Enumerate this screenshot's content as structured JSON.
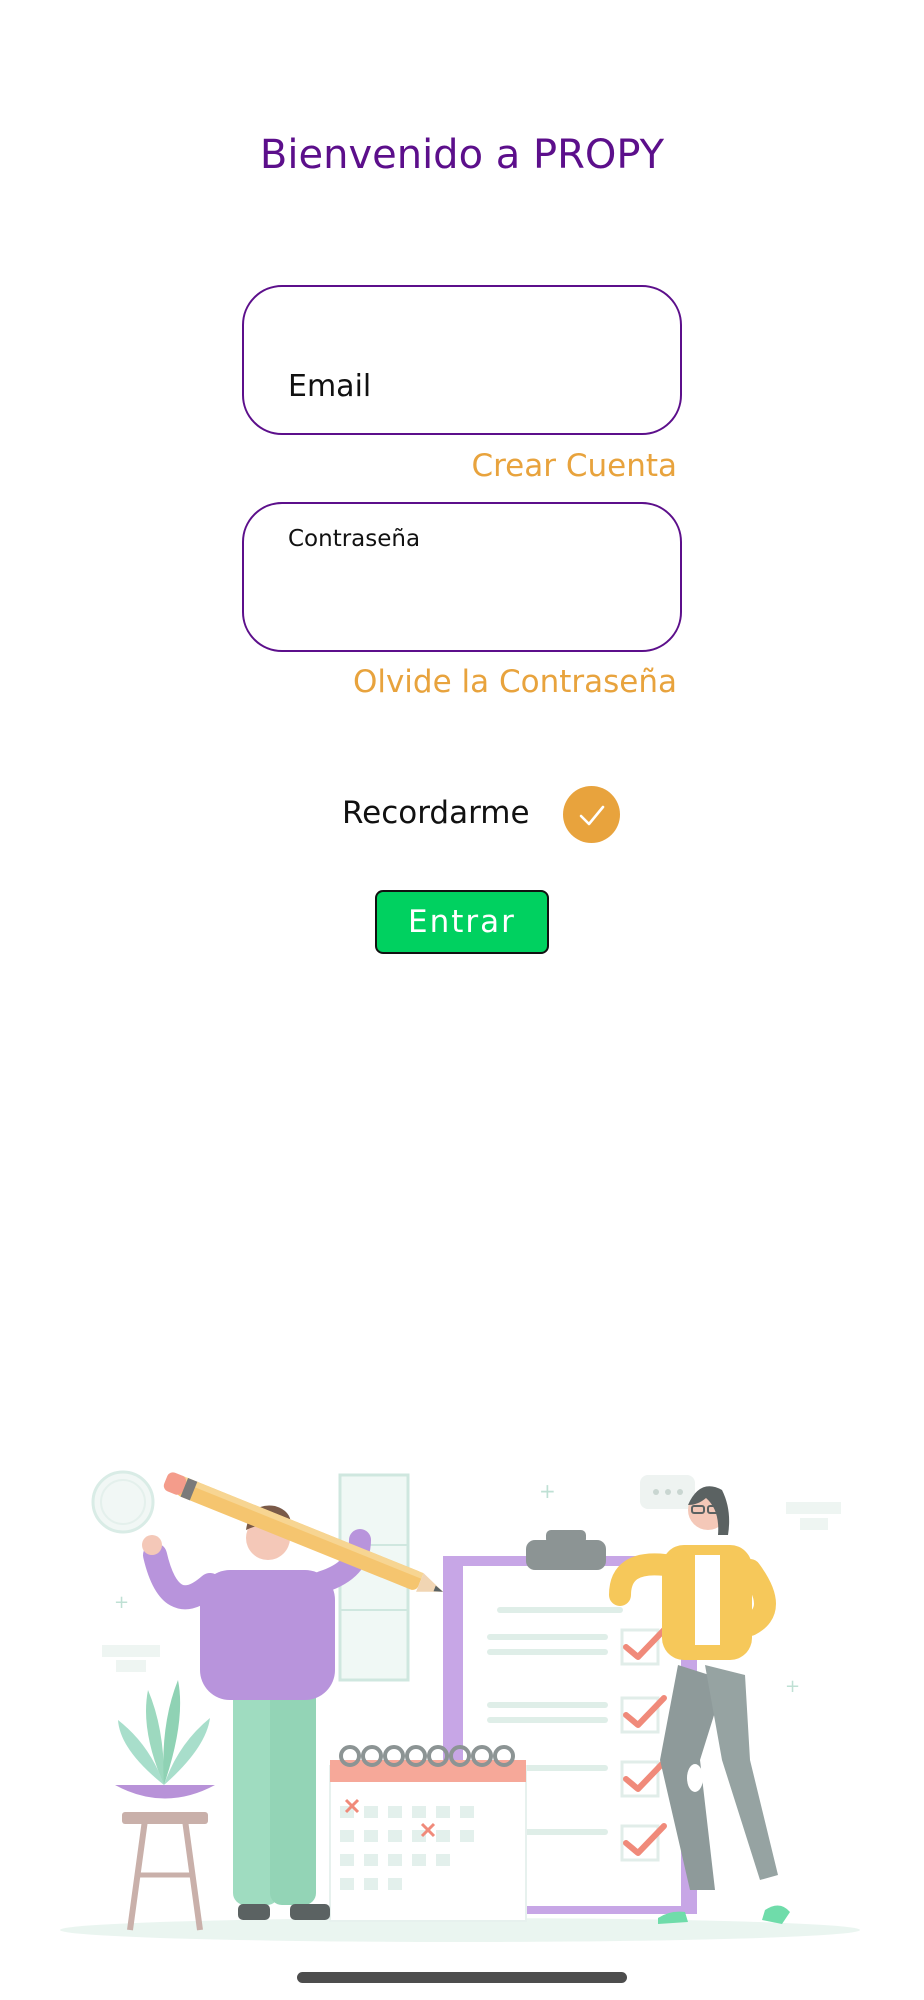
{
  "header": {
    "title": "Bienvenido a PROPY"
  },
  "form": {
    "email_label": "Email",
    "create_account_link": "Crear Cuenta",
    "password_label": "Contraseña",
    "forgot_password_link": "Olvide la Contraseña",
    "remember_label": "Recordarme",
    "remember_checked": true,
    "submit_label": "Entrar"
  },
  "colors": {
    "primary": "#5c0f8b",
    "accent": "#e8a33d",
    "button": "#00d160"
  },
  "icons": {
    "checkbox": "check-icon",
    "illustration": "team-checklist-illustration"
  }
}
